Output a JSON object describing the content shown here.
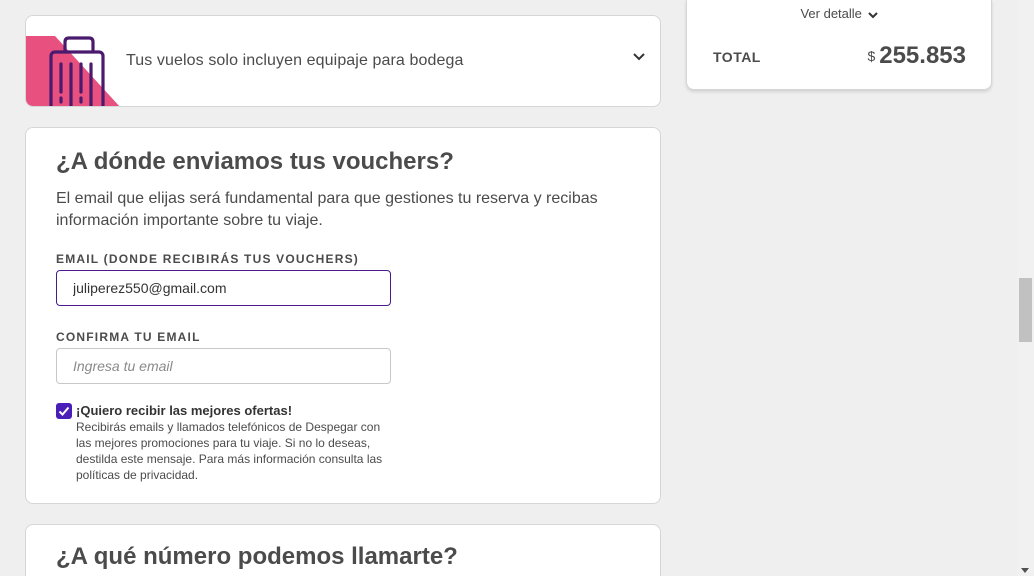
{
  "baggage": {
    "message": "Tus vuelos solo incluyen equipaje para bodega",
    "icon": "suitcase-icon"
  },
  "summary": {
    "detail_link": "Ver detalle",
    "total_label": "TOTAL",
    "currency": "$",
    "total_amount": "255.853"
  },
  "voucher": {
    "title": "¿A dónde enviamos tus vouchers?",
    "description": "El email que elijas será fundamental para que gestiones tu reserva y recibas información importante sobre tu viaje.",
    "email_label": "EMAIL (DONDE RECIBIRÁS TUS VOUCHERS)",
    "email_value": "juliperez550@gmail.com",
    "confirm_label": "CONFIRMA TU EMAIL",
    "confirm_placeholder": "Ingresa tu email",
    "offers_title": "¡Quiero recibir las mejores ofertas!",
    "offers_checked": true,
    "offers_description": "Recibirás emails y llamados telefónicos de Despegar con las mejores promociones para tu viaje. Si no lo deseas, destilda este mensaje. Para más información consulta las políticas de privacidad."
  },
  "phone": {
    "title": "¿A qué número podemos llamarte?"
  },
  "colors": {
    "brand_purple": "#4a1a8c",
    "checkbox": "#4a1fb8",
    "accent_pink": "#e8507f"
  }
}
